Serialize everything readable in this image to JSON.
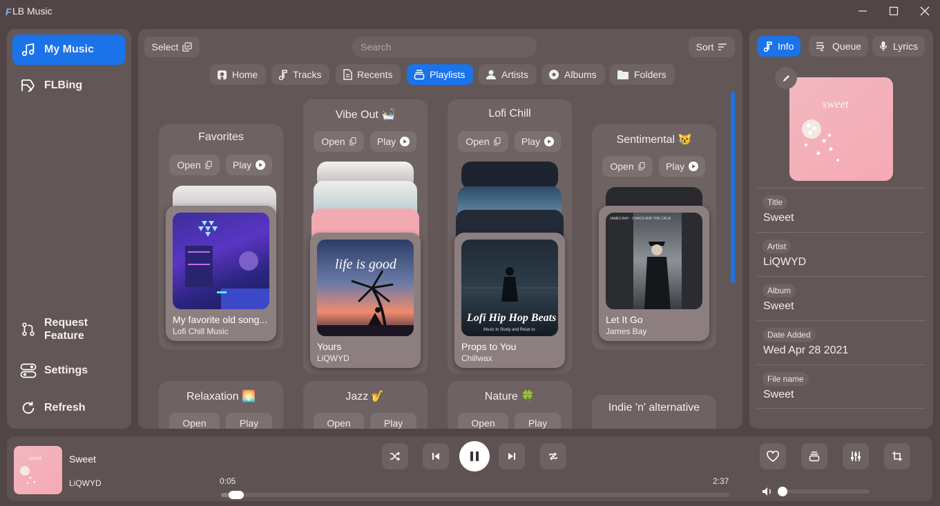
{
  "window": {
    "logo": "F",
    "title": "LB Music"
  },
  "sidebar": {
    "top_items": [
      {
        "label": "My Music",
        "icon": "music-note-icon"
      },
      {
        "label": "FLBing",
        "icon": "flbing-logo-icon"
      }
    ],
    "bottom_items": [
      {
        "label": "Request Feature",
        "icon": "pull-request-icon"
      },
      {
        "label": "Settings",
        "icon": "toggle-settings-icon"
      },
      {
        "label": "Refresh",
        "icon": "refresh-icon"
      }
    ]
  },
  "toolbar": {
    "select_label": "Select",
    "search_placeholder": "Search",
    "sort_label": "Sort"
  },
  "tabs": [
    {
      "label": "Home",
      "icon": "home-icon"
    },
    {
      "label": "Tracks",
      "icon": "music-note-icon"
    },
    {
      "label": "Recents",
      "icon": "document-icon"
    },
    {
      "label": "Playlists",
      "icon": "stack-icon",
      "active": true
    },
    {
      "label": "Artists",
      "icon": "person-icon"
    },
    {
      "label": "Albums",
      "icon": "disc-icon"
    },
    {
      "label": "Folders",
      "icon": "folder-icon"
    }
  ],
  "playlist_buttons": {
    "open": "Open",
    "play": "Play"
  },
  "playlists": [
    {
      "name": "Favorites",
      "emoji": "",
      "song": "My favorite old song...",
      "artist": "Lofi Chill Music"
    },
    {
      "name": "Vibe Out",
      "emoji": "🛀",
      "song": "Yours",
      "artist": "LiQWYD"
    },
    {
      "name": "Lofi Chill",
      "emoji": "",
      "song": "Props to You",
      "artist": "Chillwax"
    },
    {
      "name": "Sentimental",
      "emoji": "😿",
      "song": "Let It Go",
      "artist": "James Bay"
    },
    {
      "name": "Relaxation",
      "emoji": "🌅"
    },
    {
      "name": "Jazz",
      "emoji": "🎷"
    },
    {
      "name": "Nature",
      "emoji": "🍀"
    },
    {
      "name": "Indie 'n' alternative",
      "emoji": ""
    }
  ],
  "right_panel": {
    "tabs": [
      {
        "label": "Info",
        "icon": "music-note-icon",
        "active": true
      },
      {
        "label": "Queue",
        "icon": "queue-icon"
      },
      {
        "label": "Lyrics",
        "icon": "microphone-icon"
      }
    ],
    "fields": [
      {
        "label": "Title",
        "value": "Sweet"
      },
      {
        "label": "Artist",
        "value": "LiQWYD"
      },
      {
        "label": "Album",
        "value": "Sweet"
      },
      {
        "label": "Date Added",
        "value": "Wed Apr 28 2021"
      },
      {
        "label": "File name",
        "value": "Sweet"
      }
    ]
  },
  "player": {
    "title": "Sweet",
    "artist": "LiQWYD",
    "elapsed": "0:05",
    "duration": "2:37",
    "progress": 0.03,
    "volume": 0.02,
    "state": "playing"
  },
  "colors": {
    "accent": "#1a73e8",
    "background": "#524545",
    "panel": "#625656"
  }
}
